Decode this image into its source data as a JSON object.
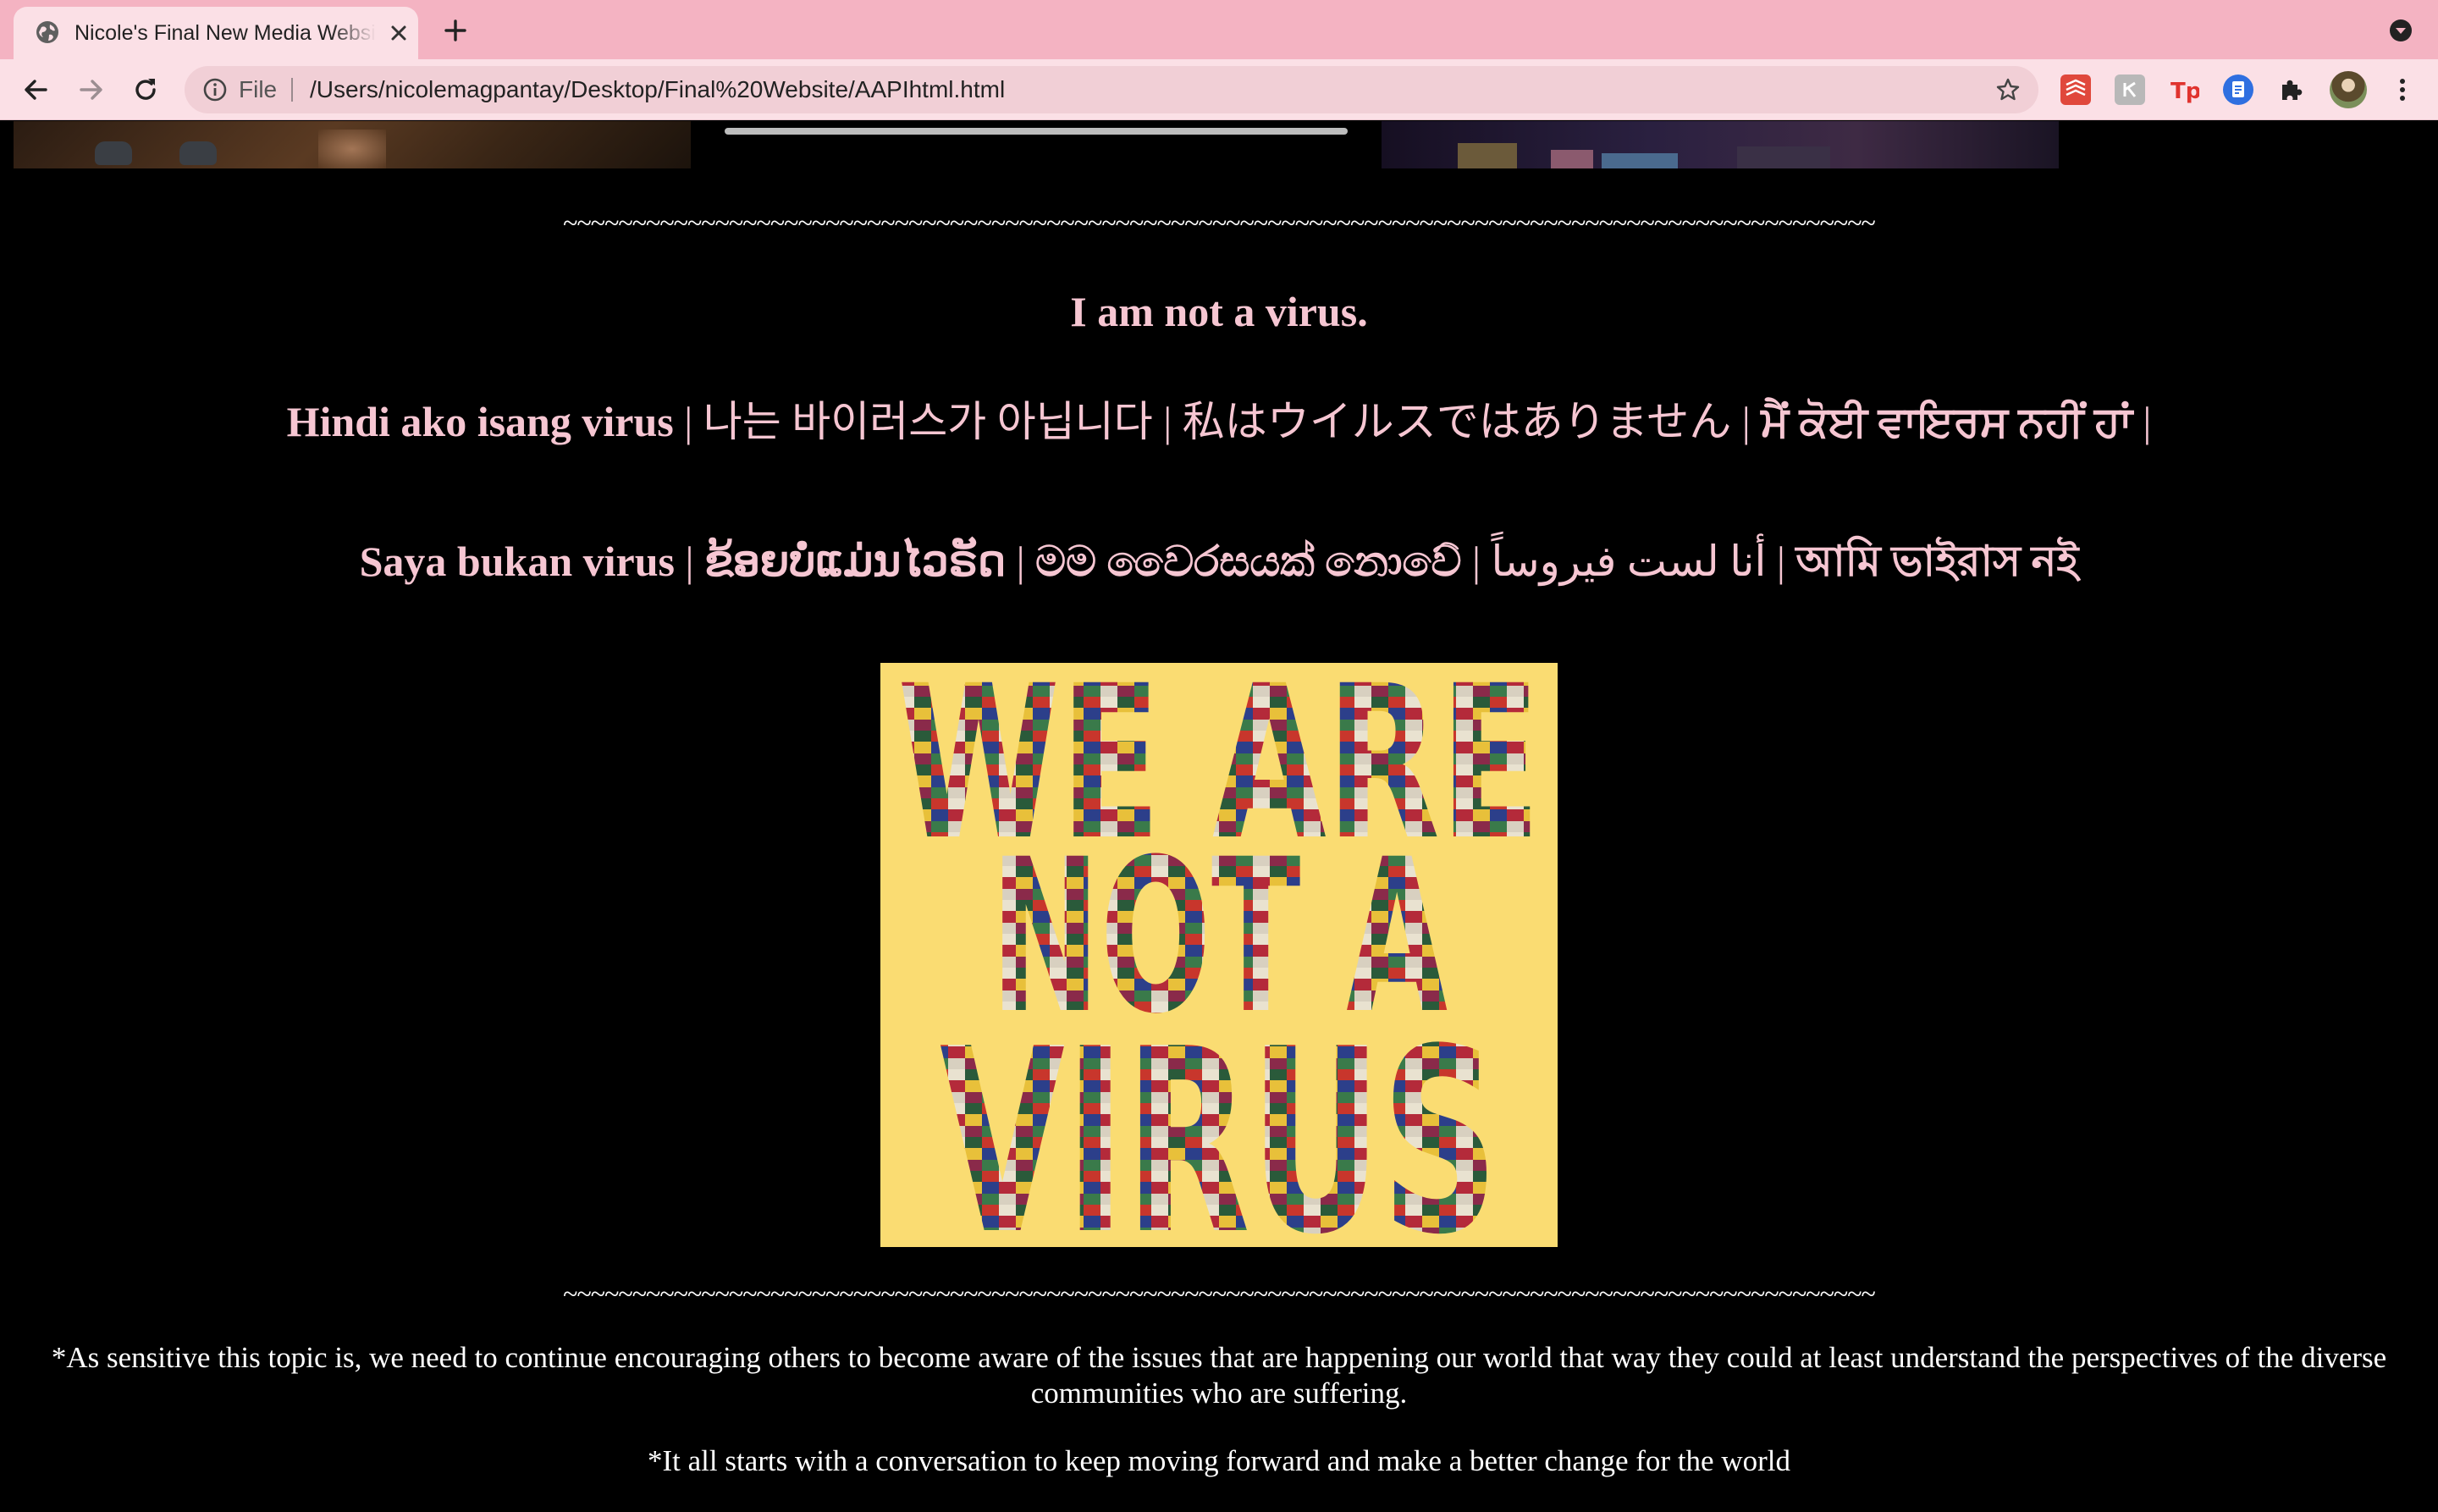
{
  "browser": {
    "tab_title": "Nicole's Final New Media Website",
    "scheme_label": "File",
    "url": "/Users/nicolemagpantay/Desktop/Final%20Website/AAPIhtml.html",
    "theme_color": "#f4b3c2",
    "toolbar_color": "#fbe0e6",
    "extensions": [
      "todoist-icon",
      "gray-extension-icon",
      "tp-extension-icon",
      "blue-doc-extension-icon",
      "puzzle-extensions-icon"
    ]
  },
  "page": {
    "tilde_divider": "~~~~~~~~~~~~~~~~~~~~~~~~~~~~~~~~~~~~~~~~~~~~~~~~~~~~~~~~~~~~~~~~~~~~~~~~~~~~~~~~~~~~~~~~~~~~~~~",
    "headline": "I am not a virus.",
    "line1": {
      "filipino": "Hindi ako isang virus",
      "korean": "나는 바이러스가 아닙니다",
      "japanese": "私はウイルスではありません",
      "punjabi": "ਮੈਂ ਕੋਈ ਵਾਇਰਸ ਨਹੀਂ ਹਾਂ",
      "separator": " | ",
      "trailing": " |"
    },
    "line2": {
      "malay": "Saya bukan virus",
      "lao": "ຂ້ອຍບໍ່ແມ່ນໄວຣັດ",
      "sinhala": "මම වෛරසයක් නොවේ",
      "arabic": "أنا لست فيروساً",
      "bengali": "আমি ভাইরাস নই",
      "separator": " | "
    },
    "poster": {
      "lines": [
        "WE ARE",
        "NOT A",
        "VIRUS"
      ],
      "background_color": "#fadc72"
    },
    "note1": "*As sensitive this topic is, we need to continue encouraging others to become aware of the issues that are happening our world that way they could at least understand the perspectives of the diverse communities who are suffering.",
    "note2": "*It all starts with a conversation to keep moving forward and make a better change for the world",
    "text_color_pink": "#f6c6d2"
  }
}
